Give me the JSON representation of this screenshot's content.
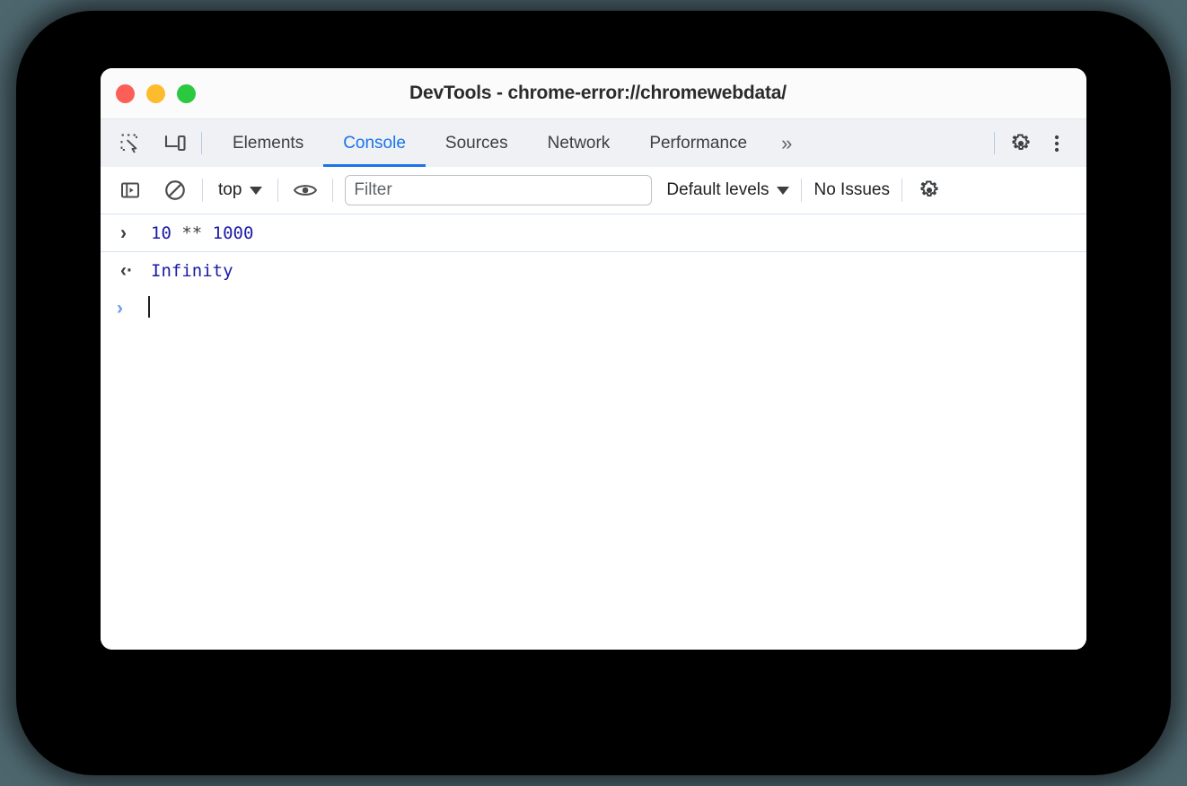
{
  "window": {
    "title": "DevTools - chrome-error://chromewebdata/",
    "traffic_lights": [
      {
        "name": "close",
        "color": "#fb5f57"
      },
      {
        "name": "minimize",
        "color": "#fdbc2e"
      },
      {
        "name": "maximize",
        "color": "#2bc93f"
      }
    ]
  },
  "tabstrip": {
    "left_icons": [
      {
        "name": "inspect-element-icon",
        "label": "Inspect element"
      },
      {
        "name": "device-toolbar-icon",
        "label": "Toggle device toolbar"
      }
    ],
    "tabs": [
      {
        "label": "Elements",
        "active": false
      },
      {
        "label": "Console",
        "active": true
      },
      {
        "label": "Sources",
        "active": false
      },
      {
        "label": "Network",
        "active": false
      },
      {
        "label": "Performance",
        "active": false
      }
    ],
    "more_label": "»",
    "right_icons": [
      {
        "name": "settings-gear-icon",
        "label": "Settings"
      },
      {
        "name": "more-options-icon",
        "label": "Customize and control DevTools"
      }
    ],
    "active_color": "#1a73e8"
  },
  "console_toolbar": {
    "sidebar_toggle": {
      "name": "console-sidebar-icon",
      "label": "Show console sidebar"
    },
    "clear_console": {
      "name": "clear-console-icon",
      "label": "Clear console"
    },
    "context": {
      "value": "top",
      "caret": "▼"
    },
    "eye": {
      "name": "live-expression-icon",
      "label": "Create live expression"
    },
    "filter": {
      "value": "",
      "placeholder": "Filter"
    },
    "levels": {
      "value": "Default levels",
      "caret": "▼"
    },
    "issues": "No Issues",
    "settings": {
      "name": "console-settings-icon",
      "label": "Console settings"
    }
  },
  "console": {
    "input_prompt": "›",
    "output_prompt": "‹·",
    "active_prompt": "›",
    "entries": [
      {
        "type": "input",
        "tokens": [
          {
            "text": "10",
            "kind": "number"
          },
          {
            "text": " ** ",
            "kind": "operator"
          },
          {
            "text": "1000",
            "kind": "number"
          }
        ],
        "raw": "10 ** 1000"
      },
      {
        "type": "output",
        "value": "Infinity"
      },
      {
        "type": "prompt",
        "value": ""
      }
    ],
    "colors": {
      "number": "#1a1aa6",
      "operator": "#3b3b3b",
      "result": "#1a1aa6",
      "separator": "#d6e2f5"
    }
  }
}
